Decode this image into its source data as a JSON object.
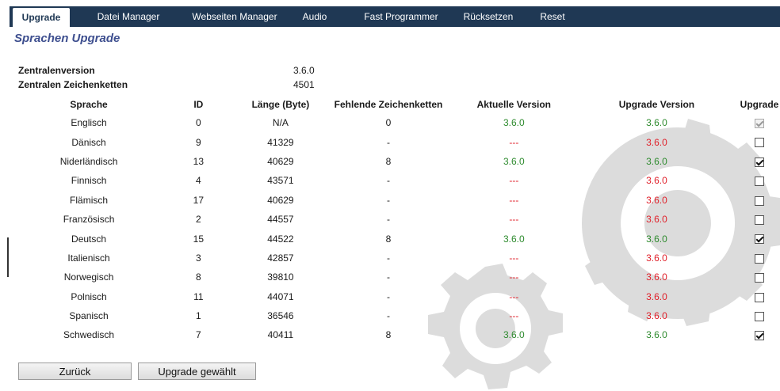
{
  "tabs": [
    "Upgrade",
    "Datei Manager",
    "Webseiten Manager",
    "Audio",
    "Fast Programmer",
    "Rücksetzen",
    "Reset"
  ],
  "page_title": "Sprachen Upgrade",
  "info": {
    "version_label": "Zentralenversion",
    "version_value": "3.6.0",
    "strings_label": "Zentralen Zeichenketten",
    "strings_value": "4501"
  },
  "table": {
    "headers": [
      "Sprache",
      "ID",
      "Länge (Byte)",
      "Fehlende Zeichenketten",
      "Aktuelle Version",
      "Upgrade Version",
      "Upgrade"
    ],
    "rows": [
      {
        "sprache": "Englisch",
        "id": "0",
        "laenge": "N/A",
        "fehlend": "0",
        "aktuell": "3.6.0",
        "aktuell_status": "green",
        "upgrade_version": "3.6.0",
        "upgrade_status": "green",
        "checked": true,
        "disabled": true
      },
      {
        "sprache": "Dänisch",
        "id": "9",
        "laenge": "41329",
        "fehlend": "-",
        "aktuell": "---",
        "aktuell_status": "red",
        "upgrade_version": "3.6.0",
        "upgrade_status": "red",
        "checked": false,
        "disabled": false
      },
      {
        "sprache": "Niderländisch",
        "id": "13",
        "laenge": "40629",
        "fehlend": "8",
        "aktuell": "3.6.0",
        "aktuell_status": "green",
        "upgrade_version": "3.6.0",
        "upgrade_status": "green",
        "checked": true,
        "disabled": false
      },
      {
        "sprache": "Finnisch",
        "id": "4",
        "laenge": "43571",
        "fehlend": "-",
        "aktuell": "---",
        "aktuell_status": "red",
        "upgrade_version": "3.6.0",
        "upgrade_status": "red",
        "checked": false,
        "disabled": false
      },
      {
        "sprache": "Flämisch",
        "id": "17",
        "laenge": "40629",
        "fehlend": "-",
        "aktuell": "---",
        "aktuell_status": "red",
        "upgrade_version": "3.6.0",
        "upgrade_status": "red",
        "checked": false,
        "disabled": false
      },
      {
        "sprache": "Französisch",
        "id": "2",
        "laenge": "44557",
        "fehlend": "-",
        "aktuell": "---",
        "aktuell_status": "red",
        "upgrade_version": "3.6.0",
        "upgrade_status": "red",
        "checked": false,
        "disabled": false
      },
      {
        "sprache": "Deutsch",
        "id": "15",
        "laenge": "44522",
        "fehlend": "8",
        "aktuell": "3.6.0",
        "aktuell_status": "green",
        "upgrade_version": "3.6.0",
        "upgrade_status": "green",
        "checked": true,
        "disabled": false
      },
      {
        "sprache": "Italienisch",
        "id": "3",
        "laenge": "42857",
        "fehlend": "-",
        "aktuell": "---",
        "aktuell_status": "red",
        "upgrade_version": "3.6.0",
        "upgrade_status": "red",
        "checked": false,
        "disabled": false
      },
      {
        "sprache": "Norwegisch",
        "id": "8",
        "laenge": "39810",
        "fehlend": "-",
        "aktuell": "---",
        "aktuell_status": "red",
        "upgrade_version": "3.6.0",
        "upgrade_status": "red",
        "checked": false,
        "disabled": false
      },
      {
        "sprache": "Polnisch",
        "id": "11",
        "laenge": "44071",
        "fehlend": "-",
        "aktuell": "---",
        "aktuell_status": "red",
        "upgrade_version": "3.6.0",
        "upgrade_status": "red",
        "checked": false,
        "disabled": false
      },
      {
        "sprache": "Spanisch",
        "id": "1",
        "laenge": "36546",
        "fehlend": "-",
        "aktuell": "---",
        "aktuell_status": "red",
        "upgrade_version": "3.6.0",
        "upgrade_status": "red",
        "checked": false,
        "disabled": false
      },
      {
        "sprache": "Schwedisch",
        "id": "7",
        "laenge": "40411",
        "fehlend": "8",
        "aktuell": "3.6.0",
        "aktuell_status": "green",
        "upgrade_version": "3.6.0",
        "upgrade_status": "green",
        "checked": true,
        "disabled": false
      }
    ]
  },
  "buttons": {
    "back": "Zurück",
    "upgrade_selected": "Upgrade gewählt"
  },
  "colors": {
    "nav_bg": "#1f3854",
    "title": "#3e4f8f",
    "ok": "#2e8b2e",
    "missing": "#e0202a",
    "watermark": "#dcdcdc"
  },
  "icons": [
    "gear-icon-large",
    "gear-icon-small"
  ]
}
